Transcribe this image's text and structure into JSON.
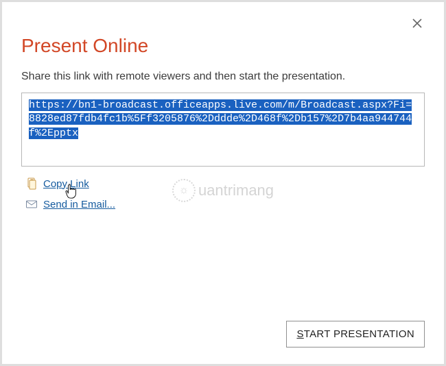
{
  "dialog": {
    "title": "Present Online",
    "subtitle": "Share this link with remote viewers and then start the presentation.",
    "link_url": "https://bn1-broadcast.officeapps.live.com/m/Broadcast.aspx?Fi=8828ed87fdb4fc1b%5Ff3205876%2Dddde%2D468f%2Db157%2D7b4aa944744f%2Epptx",
    "copy_link_label": "Copy Link",
    "send_email_label": "Send in Email...",
    "start_button_prefix": "S",
    "start_button_rest": "TART PRESENTATION"
  },
  "watermark": {
    "text": "uantrimang"
  },
  "colors": {
    "accent": "#d24726",
    "link": "#145a9e",
    "selection": "#1a61c0"
  }
}
